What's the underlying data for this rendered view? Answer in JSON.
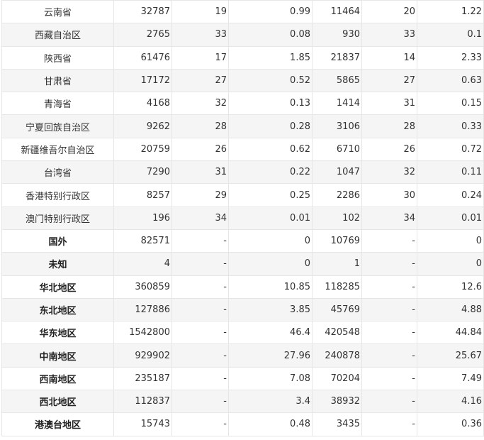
{
  "table": {
    "rows": [
      {
        "name": "云南省",
        "v1": "32787",
        "v2": "19",
        "v3": "0.99",
        "v4": "11464",
        "v5": "20",
        "v6": "1.22"
      },
      {
        "name": "西藏自治区",
        "v1": "2765",
        "v2": "33",
        "v3": "0.08",
        "v4": "930",
        "v5": "33",
        "v6": "0.1"
      },
      {
        "name": "陕西省",
        "v1": "61476",
        "v2": "17",
        "v3": "1.85",
        "v4": "21837",
        "v5": "14",
        "v6": "2.33"
      },
      {
        "name": "甘肃省",
        "v1": "17172",
        "v2": "27",
        "v3": "0.52",
        "v4": "5865",
        "v5": "27",
        "v6": "0.63"
      },
      {
        "name": "青海省",
        "v1": "4168",
        "v2": "32",
        "v3": "0.13",
        "v4": "1414",
        "v5": "31",
        "v6": "0.15"
      },
      {
        "name": "宁夏回族自治区",
        "v1": "9262",
        "v2": "28",
        "v3": "0.28",
        "v4": "3106",
        "v5": "28",
        "v6": "0.33"
      },
      {
        "name": "新疆维吾尔自治区",
        "v1": "20759",
        "v2": "26",
        "v3": "0.62",
        "v4": "6710",
        "v5": "26",
        "v6": "0.72"
      },
      {
        "name": "台湾省",
        "v1": "7290",
        "v2": "31",
        "v3": "0.22",
        "v4": "1047",
        "v5": "32",
        "v6": "0.11"
      },
      {
        "name": "香港特别行政区",
        "v1": "8257",
        "v2": "29",
        "v3": "0.25",
        "v4": "2286",
        "v5": "30",
        "v6": "0.24"
      },
      {
        "name": "澳门特别行政区",
        "v1": "196",
        "v2": "34",
        "v3": "0.01",
        "v4": "102",
        "v5": "34",
        "v6": "0.01"
      },
      {
        "name": "国外",
        "v1": "82571",
        "v2": "-",
        "v3": "0",
        "v4": "10769",
        "v5": "-",
        "v6": "0"
      },
      {
        "name": "未知",
        "v1": "4",
        "v2": "-",
        "v3": "0",
        "v4": "1",
        "v5": "-",
        "v6": "0"
      },
      {
        "name": "华北地区",
        "v1": "360859",
        "v2": "-",
        "v3": "10.85",
        "v4": "118285",
        "v5": "-",
        "v6": "12.6"
      },
      {
        "name": "东北地区",
        "v1": "127886",
        "v2": "-",
        "v3": "3.85",
        "v4": "45769",
        "v5": "-",
        "v6": "4.88"
      },
      {
        "name": "华东地区",
        "v1": "1542800",
        "v2": "-",
        "v3": "46.4",
        "v4": "420548",
        "v5": "-",
        "v6": "44.84"
      },
      {
        "name": "中南地区",
        "v1": "929902",
        "v2": "-",
        "v3": "27.96",
        "v4": "240878",
        "v5": "-",
        "v6": "25.67"
      },
      {
        "name": "西南地区",
        "v1": "235187",
        "v2": "-",
        "v3": "7.08",
        "v4": "70204",
        "v5": "-",
        "v6": "7.49"
      },
      {
        "name": "西北地区",
        "v1": "112837",
        "v2": "-",
        "v3": "3.4",
        "v4": "38932",
        "v5": "-",
        "v6": "4.16"
      },
      {
        "name": "港澳台地区",
        "v1": "15743",
        "v2": "-",
        "v3": "0.48",
        "v4": "3435",
        "v5": "-",
        "v6": "0.36"
      }
    ]
  }
}
